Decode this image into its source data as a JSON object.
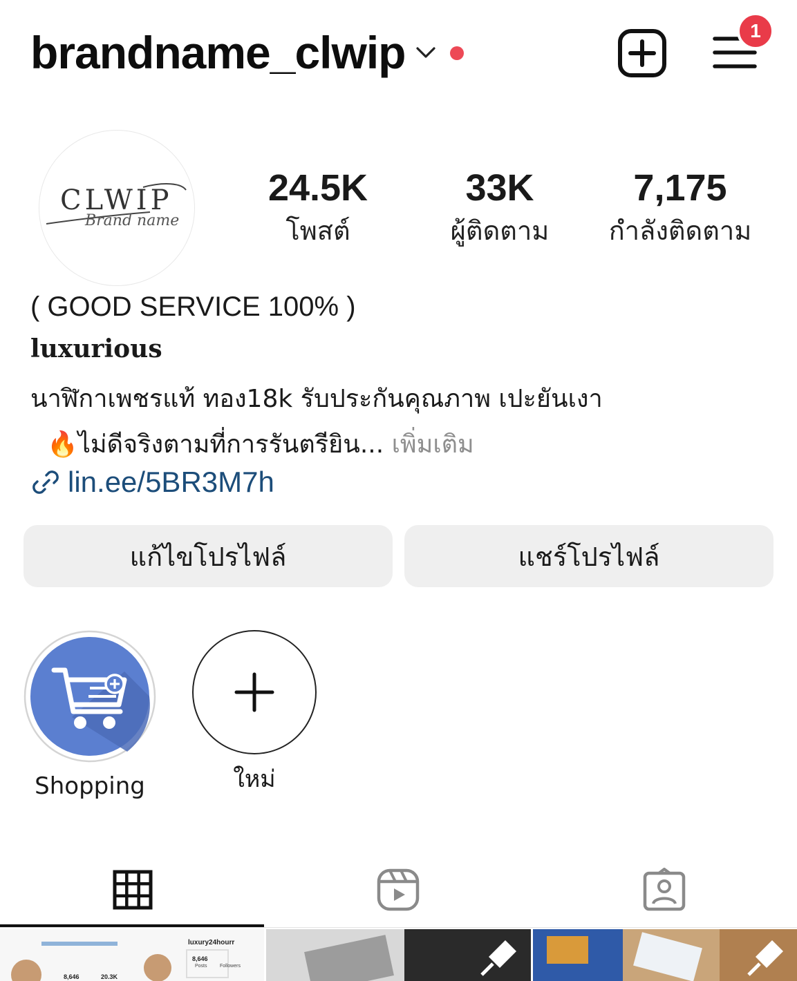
{
  "header": {
    "username": "brandname_clwip",
    "notification_count": "1",
    "icons": [
      "chevron-down-icon",
      "new-post-icon",
      "menu-icon"
    ]
  },
  "profile": {
    "avatar_brand": "CLWIP",
    "avatar_subtext": "Brand name"
  },
  "stats": [
    {
      "value": "24.5K",
      "label": "โพสต์"
    },
    {
      "value": "33K",
      "label": "ผู้ติดตาม"
    },
    {
      "value": "7,175",
      "label": "กำลังติดตาม"
    }
  ],
  "bio": {
    "title": "( GOOD SERVICE 100% )",
    "category": "luxurious",
    "line1": "นาฬิกาเพชรแท้ ทอง18k รับประกันคุณภาพ เปะยันเงา",
    "line2_emoji": "🔥",
    "line2": "ไม่ดีจริงตามที่การรันตรียิน...",
    "more": "เพิ่มเติม",
    "link": "lin.ee/5BR3M7h"
  },
  "buttons": {
    "edit_profile": "แก้ไขโปรไฟล์",
    "share_profile": "แชร์โปรไฟล์"
  },
  "highlights": [
    {
      "label": "Shopping",
      "icon": "shopping-cart-icon"
    },
    {
      "label": "ใหม่",
      "icon": "plus-icon"
    }
  ],
  "tabs": [
    {
      "name": "posts-grid",
      "icon": "grid-icon",
      "active": true
    },
    {
      "name": "reels",
      "icon": "reels-icon",
      "active": false
    },
    {
      "name": "tagged",
      "icon": "tagged-person-icon",
      "active": false
    }
  ],
  "thumbnails": {
    "post1_username": "luxury24hourr",
    "post1_value": "8,646",
    "post1_label": "Posts",
    "post1_followers_label": "Followers",
    "post1_stat_a": "8,646",
    "post1_stat_b": "20.3K"
  },
  "colors": {
    "notification_red": "#e93b49",
    "link_blue": "#1c4d7a",
    "shopping_blue": "#5b7fd0",
    "button_gray": "#efefef"
  }
}
